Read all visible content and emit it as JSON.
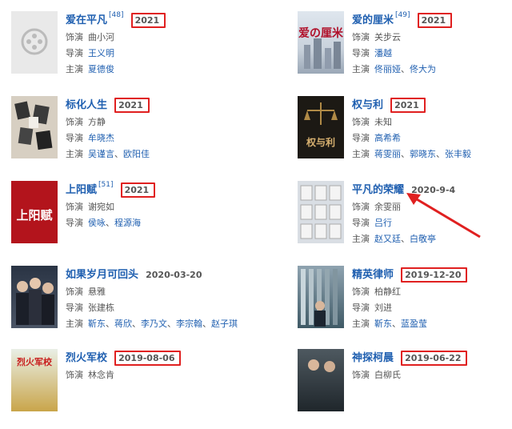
{
  "labels": {
    "writer": "饰演",
    "director": "导演",
    "cast": "主演"
  },
  "cards": [
    {
      "title": "爱在平凡",
      "ref": "[48]",
      "year": "2021",
      "writer": "曲小河",
      "director": "王义明",
      "cast": [
        "夏德俊"
      ],
      "thumb_text": ""
    },
    {
      "title": "爱的厘米",
      "ref": "[49]",
      "year": "2021",
      "writer": "关步云",
      "director": "潘越",
      "cast": [
        "佟丽娅",
        "佟大为"
      ],
      "thumb_text": "爱の厘米"
    },
    {
      "title": "标化人生",
      "ref": "",
      "year": "2021",
      "writer": "方静",
      "director": "牟晓杰",
      "cast": [
        "吴谨言",
        "欧阳佳"
      ],
      "thumb_text": ""
    },
    {
      "title": "权与利",
      "ref": "",
      "year": "2021",
      "writer": "未知",
      "director": "高希希",
      "cast": [
        "蒋雯丽",
        "郭晓东",
        "张丰毅"
      ],
      "thumb_text": "权与利"
    },
    {
      "title": "上阳赋",
      "ref": "[51]",
      "year": "2021",
      "writer": "谢宛如",
      "director": "侯咏",
      "cast": [
        "侯咏",
        "程源海"
      ],
      "thumb_text": "上阳赋"
    },
    {
      "title": "平凡的荣耀",
      "ref": "",
      "year": "2020-9-4",
      "writer": "余雯丽",
      "director": "吕行",
      "cast": [
        "赵又廷",
        "白敬亭"
      ],
      "thumb_text": ""
    },
    {
      "title": "如果岁月可回头",
      "ref": "",
      "year": "2020-03-20",
      "writer": "悬雅",
      "director": "张建栋",
      "cast": [
        "靳东",
        "蒋欣",
        "李乃文",
        "李宗翰",
        "赵子琪"
      ],
      "thumb_text": ""
    },
    {
      "title": "精英律师",
      "ref": "",
      "year": "2019-12-20",
      "writer": "柏静红",
      "director": "刘进",
      "cast": [
        "靳东",
        "蓝盈莹"
      ],
      "thumb_text": ""
    },
    {
      "title": "烈火军校",
      "ref": "",
      "year": "2019-08-06",
      "writer": "林念肯",
      "director": "",
      "cast": [],
      "thumb_text": "烈火军校"
    },
    {
      "title": "神探柯晨",
      "ref": "",
      "year": "2019-06-22",
      "writer": "白柳氏",
      "director": "",
      "cast": [],
      "thumb_text": ""
    }
  ]
}
